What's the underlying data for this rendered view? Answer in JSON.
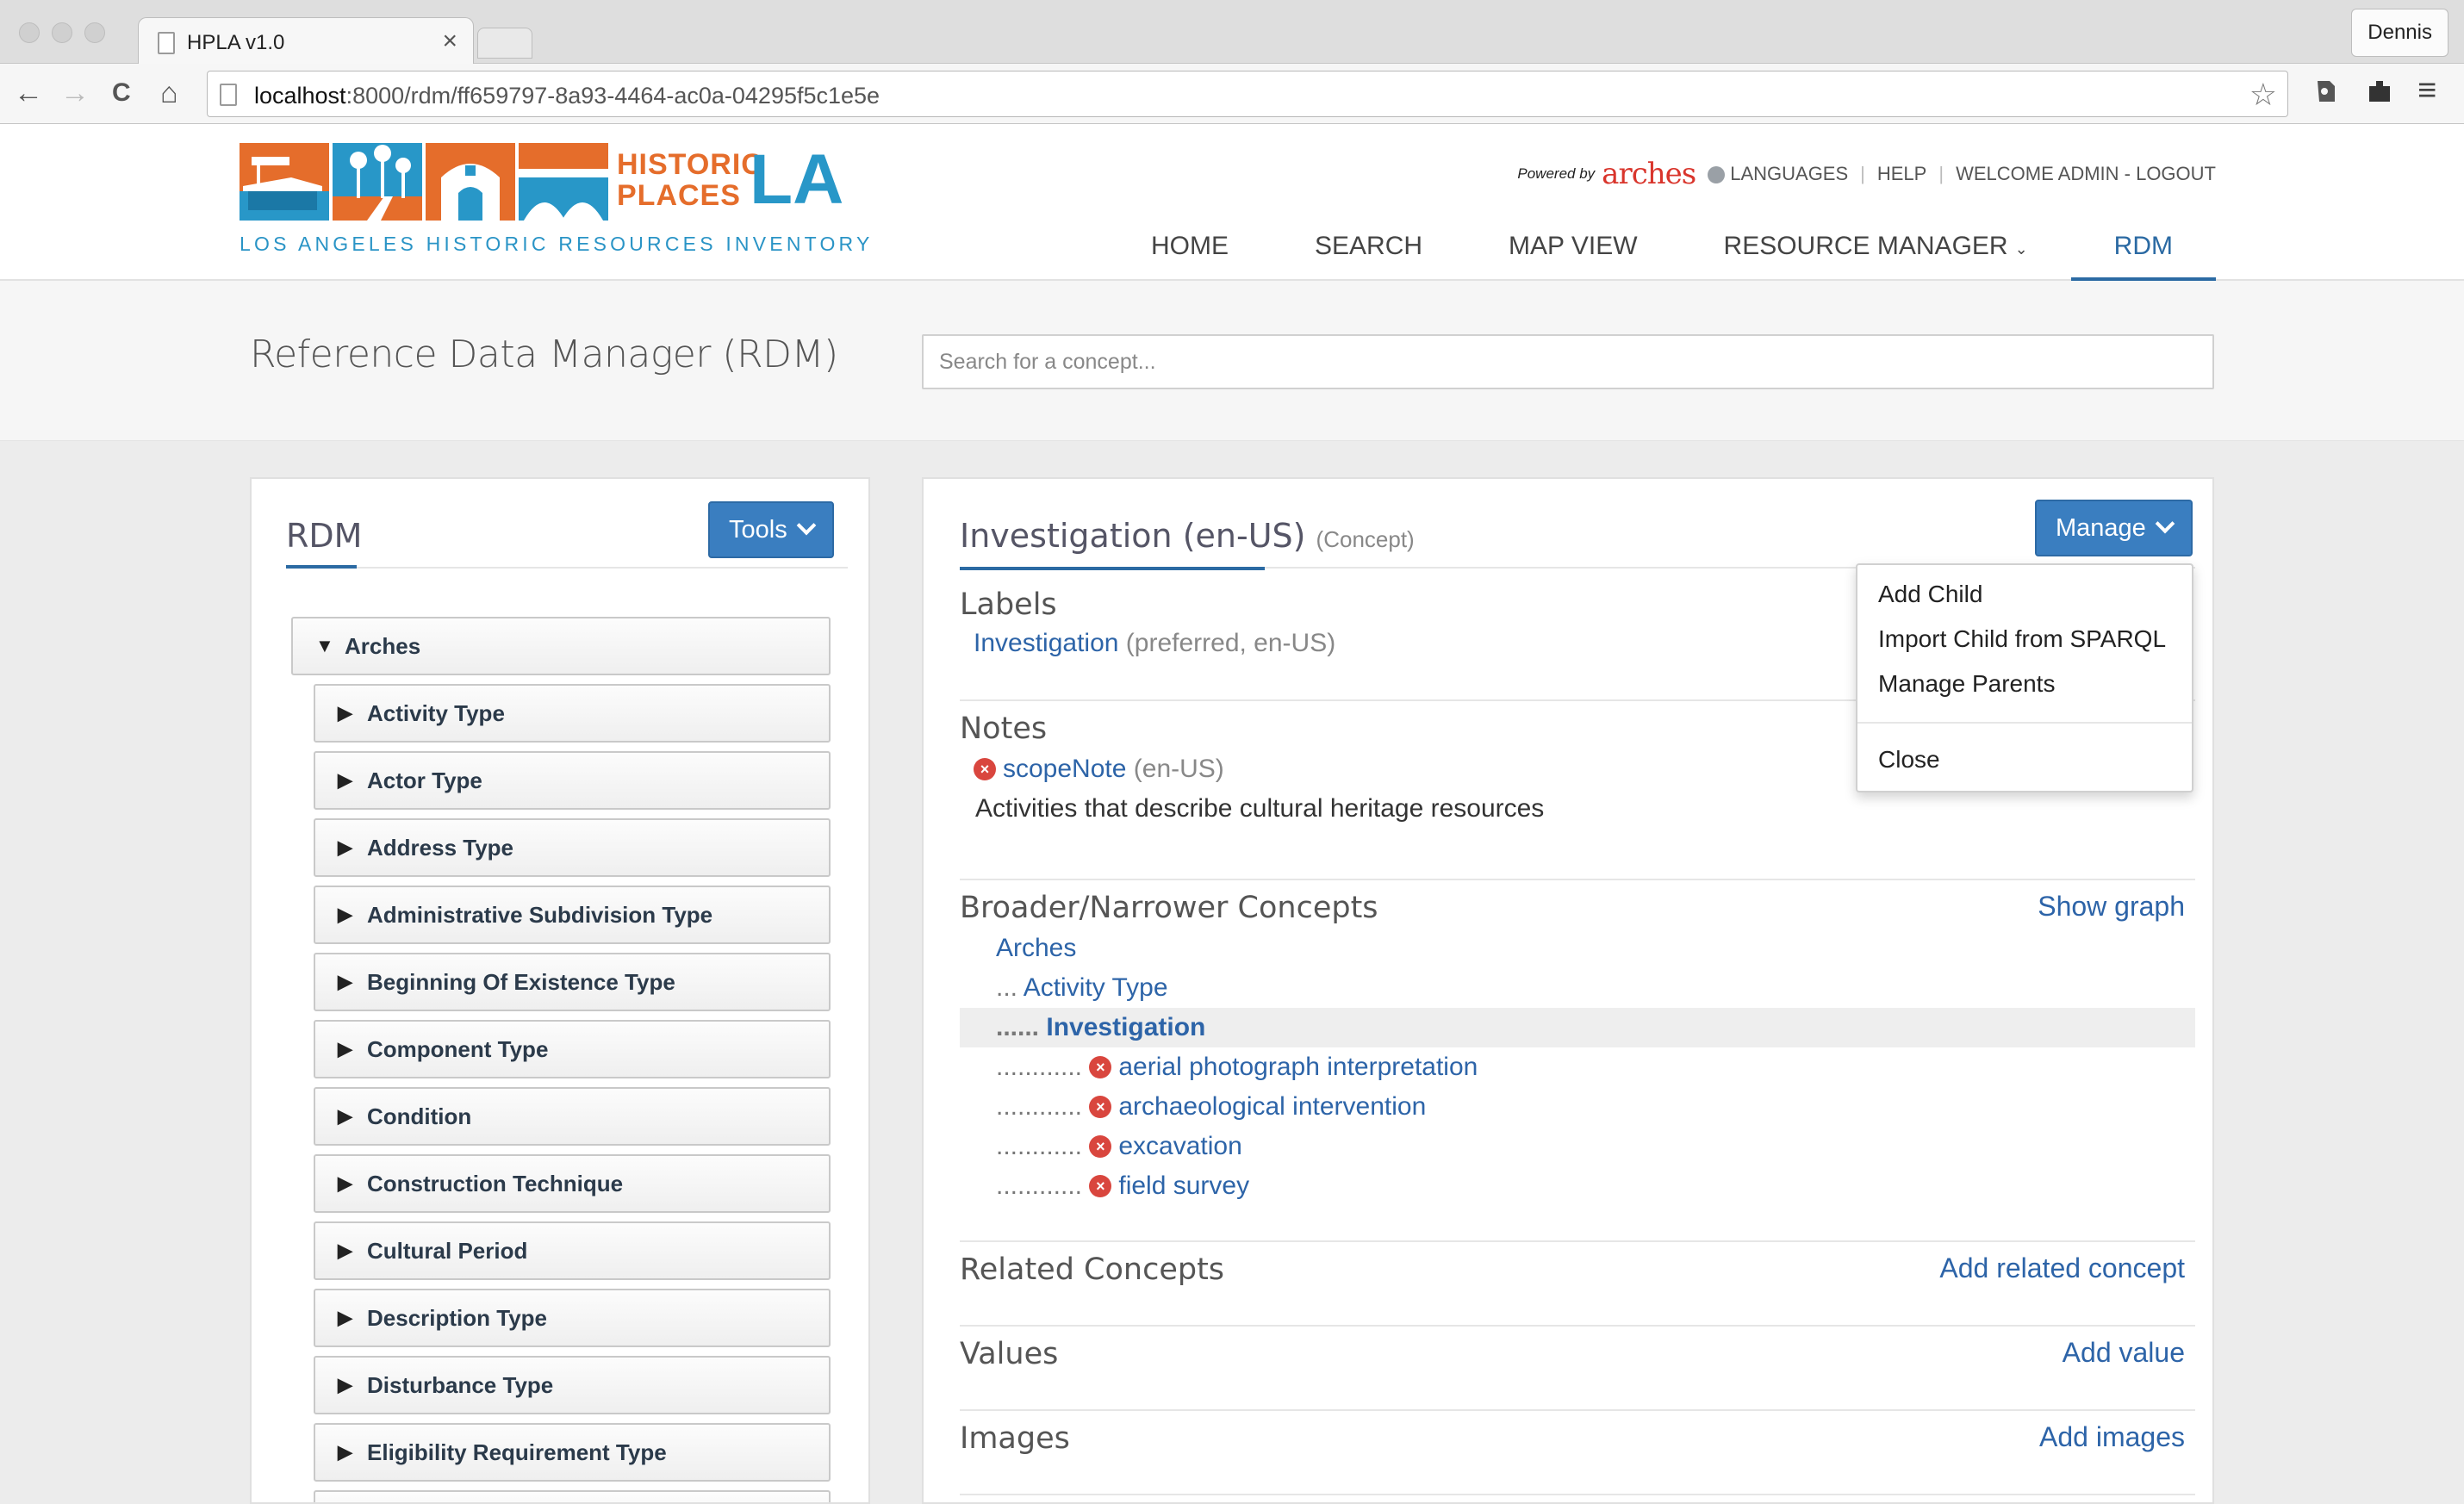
{
  "browser": {
    "tab_title": "HPLA v1.0",
    "tab_close": "×",
    "profile_name": "Dennis",
    "url_host": "localhost",
    "url_path": ":8000/rdm/ff659797-8a93-4464-ac0a-04295f5c1e5e",
    "icons": {
      "back": "←",
      "forward": "→",
      "reload": "C",
      "home": "⌂",
      "star": "☆",
      "menu": "≡"
    }
  },
  "header": {
    "logo_line1": "HISTORIC",
    "logo_line2": "PLACES",
    "logo_la": "LA",
    "logo_subtitle": "LOS ANGELES HISTORIC RESOURCES INVENTORY",
    "powered_by": "Powered by",
    "arches_brand": "arches",
    "languages": "LANGUAGES",
    "help": "HELP",
    "welcome": "WELCOME ADMIN - LOGOUT",
    "separator": "|",
    "nav": {
      "home": "HOME",
      "search": "SEARCH",
      "map_view": "MAP VIEW",
      "resource_manager": "RESOURCE MANAGER",
      "resource_manager_caret": "⌄",
      "rdm": "RDM"
    }
  },
  "page": {
    "title": "Reference Data Manager (RDM)",
    "search_placeholder": "Search for a concept..."
  },
  "left_panel": {
    "heading": "RDM",
    "tools_label": "Tools",
    "root_arrow": "▼",
    "child_arrow": "▶",
    "root": "Arches",
    "children": [
      "Activity Type",
      "Actor Type",
      "Address Type",
      "Administrative Subdivision Type",
      "Beginning Of Existence Type",
      "Component Type",
      "Condition",
      "Construction Technique",
      "Cultural Period",
      "Description Type",
      "Disturbance Type",
      "Eligibility Requirement Type"
    ]
  },
  "concept": {
    "title": "Investigation (en-US)",
    "type": "(Concept)",
    "manage_label": "Manage",
    "manage_menu": {
      "add_child": "Add Child",
      "import_sparql": "Import Child from SPARQL",
      "manage_parents": "Manage Parents",
      "close": "Close"
    },
    "labels_heading": "Labels",
    "label_value": "Investigation",
    "label_meta": "(preferred, en-US)",
    "notes_heading": "Notes",
    "note_type": "scopeNote",
    "note_lang": "(en-US)",
    "note_text": "Activities that describe cultural heritage resources",
    "delete_glyph": "×",
    "broader_heading": "Broader/Narrower Concepts",
    "show_graph": "Show graph",
    "hierarchy": {
      "root": "Arches",
      "parent_prefix": "...",
      "parent": "Activity Type",
      "current_prefix": "......",
      "current": "Investigation",
      "child_prefix": "............",
      "children": [
        "aerial photograph interpretation",
        "archaeological intervention",
        "excavation",
        "field survey"
      ]
    },
    "related_heading": "Related Concepts",
    "add_related": "Add related concept",
    "values_heading": "Values",
    "add_value": "Add value",
    "images_heading": "Images",
    "add_images": "Add images"
  }
}
